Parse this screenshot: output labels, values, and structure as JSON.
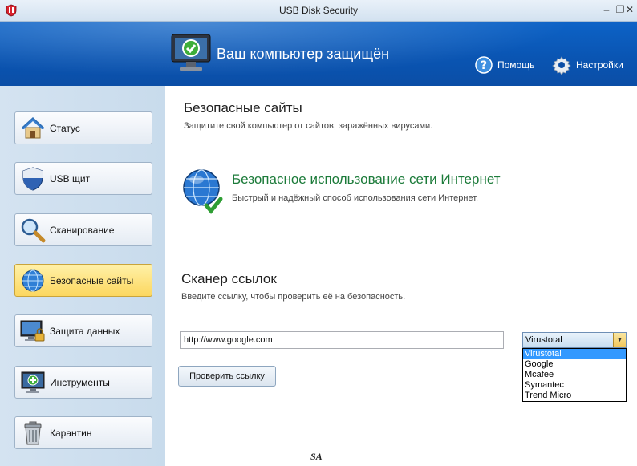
{
  "window": {
    "title": "USB Disk Security",
    "minimize": "–",
    "restore": "❐",
    "close": "✕"
  },
  "header": {
    "status_title": "Ваш компьютер защищён",
    "help_label": "Помощь",
    "settings_label": "Настройки"
  },
  "sidebar": {
    "items": [
      {
        "label": "Статус",
        "icon": "house-icon"
      },
      {
        "label": "USB щит",
        "icon": "shield-icon"
      },
      {
        "label": "Сканирование",
        "icon": "magnifier-icon"
      },
      {
        "label": "Безопасные сайты",
        "icon": "globe-icon",
        "active": true
      },
      {
        "label": "Защита данных",
        "icon": "monitor-lock-icon"
      },
      {
        "label": "Инструменты",
        "icon": "monitor-tools-icon"
      },
      {
        "label": "Карантин",
        "icon": "trash-icon"
      }
    ]
  },
  "main": {
    "section_title": "Безопасные сайты",
    "section_desc": "Защитите свой компьютер от сайтов, заражённых вирусами.",
    "feature_title": "Безопасное использование сети Интернет",
    "feature_desc": "Быстрый и надёжный способ использования сети Интернет.",
    "scanner_title": "Сканер ссылок",
    "scanner_desc": "Введите ссылку, чтобы проверить её на безопасность.",
    "url_value": "http://www.google.com",
    "check_button": "Проверить ссылку",
    "engine": {
      "selected": "Virustotal",
      "options": [
        "Virustotal",
        "Google",
        "Mcafee",
        "Symantec",
        "Trend Micro"
      ]
    }
  },
  "watermark": "SA",
  "colors": {
    "header_blue": "#0a55b3",
    "active_nav": "#fcd75f",
    "feature_green": "#1c7b3a",
    "highlight": "#3399ff"
  }
}
